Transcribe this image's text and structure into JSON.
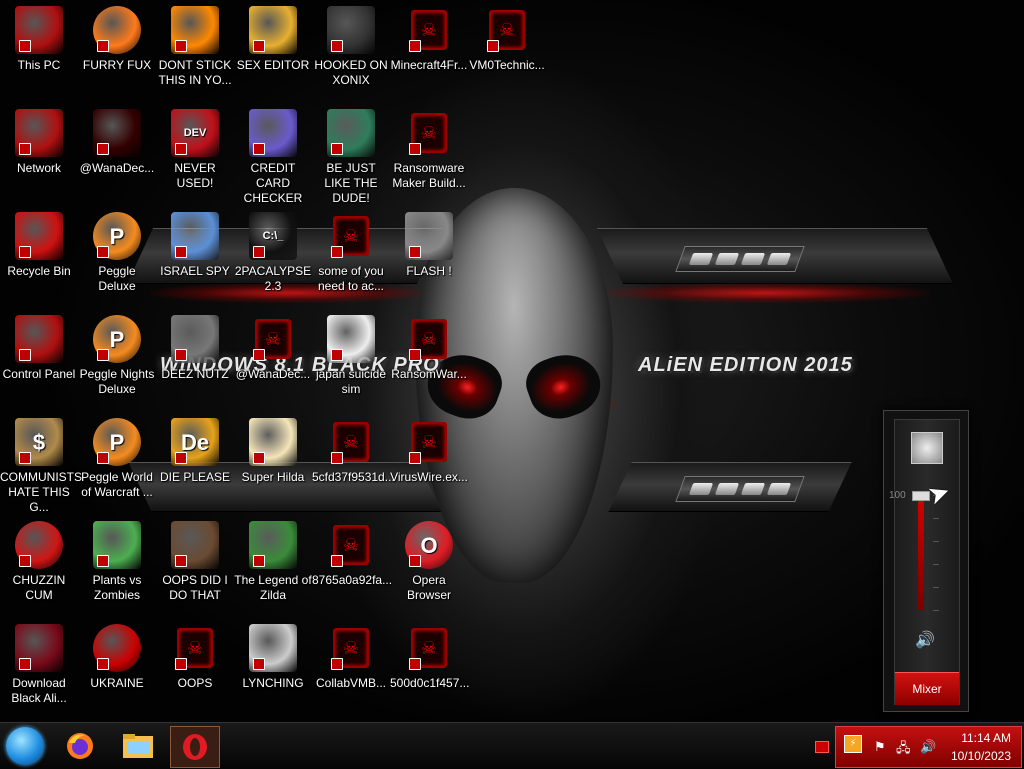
{
  "wallpaper": {
    "left_text": "WiNDOWS 8.1 BLACK PRO",
    "right_text": "ALiEN EDITION 2015"
  },
  "icons": [
    {
      "label": "This PC",
      "icon": "computer-icon"
    },
    {
      "label": "FURRY FUX",
      "icon": "firefox-icon"
    },
    {
      "label": "DONT STICK THIS IN YO...",
      "icon": "vlc-cone-icon"
    },
    {
      "label": "SEX EDITOR",
      "icon": "xd-editor-icon"
    },
    {
      "label": "HOOKED ON XONIX",
      "icon": "xonix-game-icon"
    },
    {
      "label": "Minecraft4Fr...",
      "icon": "exe-icon"
    },
    {
      "label": "VM0Technic...",
      "icon": "exe-icon"
    },
    {
      "label": "Network",
      "icon": "network-icon"
    },
    {
      "label": "@WanaDec...",
      "icon": "wanadecryptor-icon"
    },
    {
      "label": "NEVER USED!",
      "icon": "devcpp-icon",
      "icon_text": "DEV"
    },
    {
      "label": "CREDIT CARD CHECKER",
      "icon": "credit-card-icon"
    },
    {
      "label": "BE JUST LIKE THE DUDE!",
      "icon": "dude-icon"
    },
    {
      "label": "Ransomware Maker Build...",
      "icon": "exe-icon"
    },
    {
      "label": "Recycle Bin",
      "icon": "recycle-bin-icon"
    },
    {
      "label": "Peggle Deluxe",
      "icon": "peggle-icon",
      "icon_text": "P"
    },
    {
      "label": "ISRAEL SPY",
      "icon": "spy-tool-icon"
    },
    {
      "label": "2PACALYPSE 2.3",
      "icon": "terminal-icon",
      "icon_text": "C:\\_"
    },
    {
      "label": "some of you need to ac...",
      "icon": "exe-icon"
    },
    {
      "label": "FLASH !",
      "icon": "flash-icon"
    },
    {
      "label": "Control Panel",
      "icon": "control-panel-icon"
    },
    {
      "label": "Peggle Nights Deluxe",
      "icon": "peggle-icon",
      "icon_text": "P"
    },
    {
      "label": "DEEZ NUTZ",
      "icon": "stacked-windows-icon"
    },
    {
      "label": "@WanaDec...",
      "icon": "exe-icon"
    },
    {
      "label": "japan suicide sim",
      "icon": "document-icon"
    },
    {
      "label": "RansomWar...",
      "icon": "exe-icon"
    },
    {
      "label": "COMMUNISTS HATE THIS G...",
      "icon": "money-bag-icon",
      "icon_text": "$"
    },
    {
      "label": "Peggle World of Warcraft ...",
      "icon": "peggle-icon",
      "icon_text": "P"
    },
    {
      "label": "DIE PLEASE",
      "icon": "de-icon",
      "icon_text": "De"
    },
    {
      "label": "Super Hilda",
      "icon": "pixel-sprite-icon"
    },
    {
      "label": "5cfd37f9531d...",
      "icon": "exe-icon"
    },
    {
      "label": "VirusWire.ex...",
      "icon": "exe-icon"
    },
    {
      "label": "CHUZZIN CUM",
      "icon": "chuzzle-icon"
    },
    {
      "label": "Plants vs Zombies",
      "icon": "plant-icon"
    },
    {
      "label": "OOPS DID I DO THAT",
      "icon": "portrait-icon"
    },
    {
      "label": "The Legend of Zilda",
      "icon": "zelda-sprite-icon"
    },
    {
      "label": "8765a0a92fa...",
      "icon": "exe-icon"
    },
    {
      "label": "Opera Browser",
      "icon": "opera-icon",
      "icon_text": "O"
    },
    {
      "label": "Download Black Ali...",
      "icon": "download-icon"
    },
    {
      "label": "UKRAINE",
      "icon": "radiation-icon"
    },
    {
      "label": "OOPS",
      "icon": "exe-icon"
    },
    {
      "label": "LYNCHING",
      "icon": "noose-icon"
    },
    {
      "label": "CollabVMB...",
      "icon": "exe-icon"
    },
    {
      "label": "500d0c1f457...",
      "icon": "exe-icon"
    }
  ],
  "volume_mixer": {
    "level_label": "100",
    "level_percent": 100,
    "speaker_icon": "speaker-icon",
    "mixer_label": "Mixer"
  },
  "taskbar": {
    "start_icon": "start-orb-icon",
    "pinned": [
      "firefox-icon",
      "file-explorer-icon",
      "opera-icon"
    ],
    "clock_time": "11:14 AM",
    "clock_date": "10/10/2023"
  }
}
